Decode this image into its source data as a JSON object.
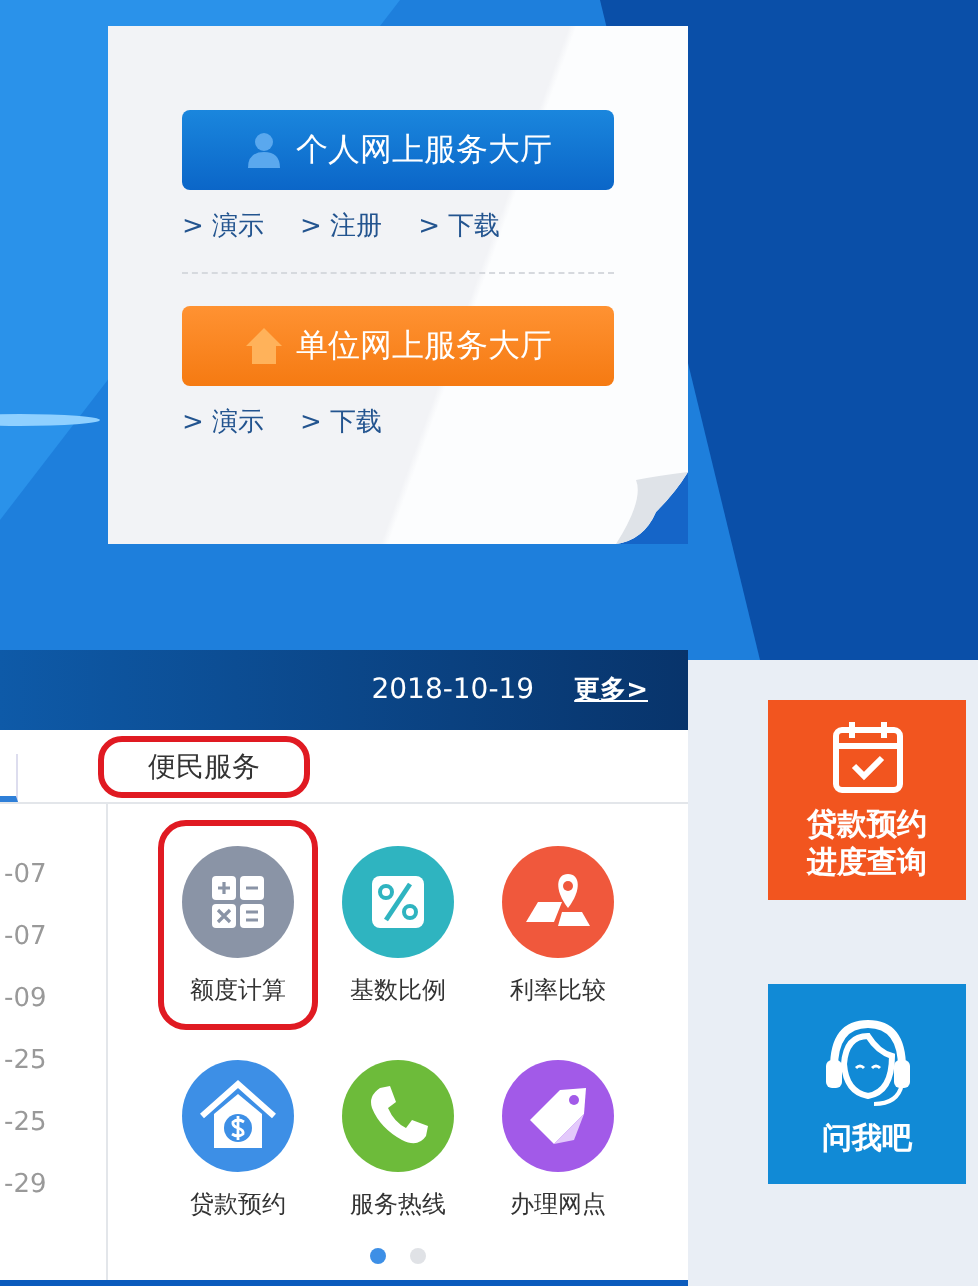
{
  "personal_hall": {
    "label": "个人网上服务大厅",
    "links": [
      "> 演示",
      "> 注册",
      "> 下载"
    ]
  },
  "unit_hall": {
    "label": "单位网上服务大厅",
    "links": [
      "> 演示",
      "> 下载"
    ]
  },
  "panel": {
    "date": "2018-10-19",
    "more": "更多>",
    "dates": [
      "-07",
      "-07",
      "-09",
      "-25",
      "-25",
      "-29"
    ],
    "tab": {
      "label": "便民服务",
      "highlighted": true
    },
    "services": [
      {
        "label": "额度计算",
        "kind": "calculator",
        "color": "#8a94a6",
        "highlighted": true
      },
      {
        "label": "基数比例",
        "kind": "percent",
        "color": "#2fb4c0",
        "highlighted": false
      },
      {
        "label": "利率比较",
        "kind": "pin",
        "color": "#f0583c",
        "highlighted": false
      },
      {
        "label": "贷款预约",
        "kind": "house",
        "color": "#3d8fe6",
        "highlighted": false
      },
      {
        "label": "服务热线",
        "kind": "phone",
        "color": "#6dbb3a",
        "highlighted": false
      },
      {
        "label": "办理网点",
        "kind": "tag",
        "color": "#a25ae8",
        "highlighted": false
      }
    ],
    "pager": [
      {
        "selected": true
      },
      {
        "selected": false
      }
    ]
  },
  "side_tiles": [
    {
      "kind": "calendar",
      "lines": [
        "贷款预约",
        "进度查询"
      ]
    },
    {
      "kind": "headset",
      "lines": [
        "问我吧"
      ]
    }
  ]
}
